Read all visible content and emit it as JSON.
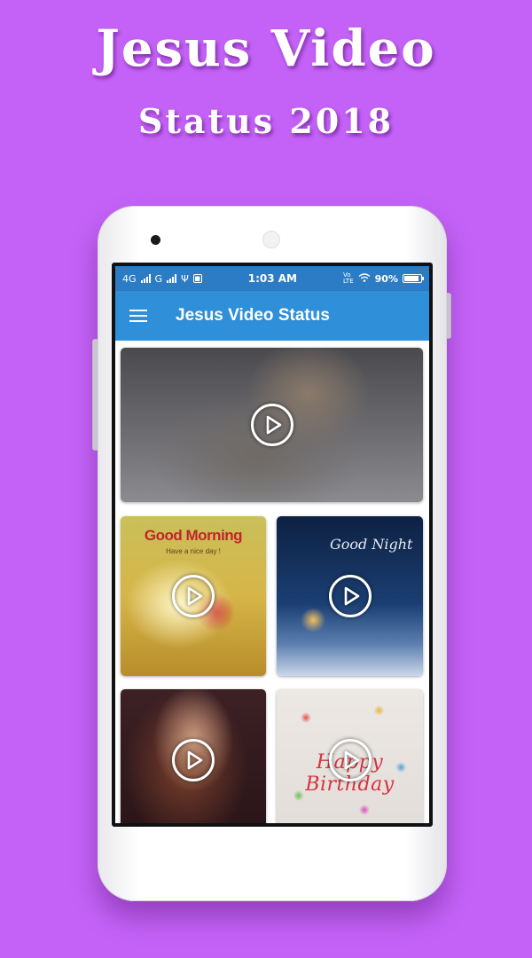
{
  "promo": {
    "headline_line1": "Jesus Video",
    "headline_line2": "Status 2018"
  },
  "status_bar": {
    "network_left": "4G",
    "network_mid": "G",
    "time": "1:03 AM",
    "volte_label": "VoLTE",
    "battery_percent": "90%",
    "battery_level": 0.9
  },
  "app_bar": {
    "menu_icon": "hamburger-menu-icon",
    "title": "Jesus Video Status"
  },
  "videos": [
    {
      "id": "featured",
      "caption": "",
      "icon": "play-icon"
    },
    {
      "id": "good-morning",
      "caption": "Good Morning",
      "subcaption": "Have a nice day !",
      "icon": "play-icon"
    },
    {
      "id": "good-night",
      "caption": "Good Night",
      "icon": "play-icon"
    },
    {
      "id": "portrait",
      "caption": "",
      "icon": "play-icon"
    },
    {
      "id": "birthday",
      "caption": "Happy Birthday",
      "icon": "play-icon"
    }
  ],
  "colors": {
    "background": "#c462f7",
    "status_bar": "#2b7cc4",
    "app_bar": "#2f8fd8",
    "text_on_bar": "#ffffff"
  }
}
